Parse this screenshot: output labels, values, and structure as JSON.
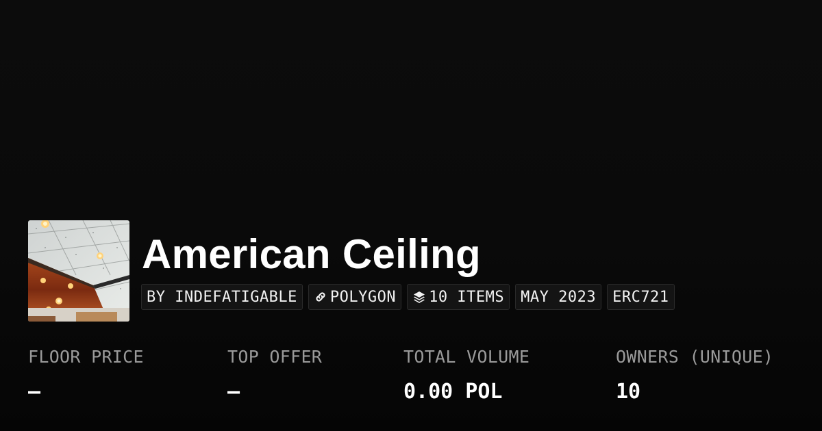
{
  "collection": {
    "title": "American Ceiling",
    "thumbnail_icon": "ceiling-artwork-image"
  },
  "pills": {
    "creator": "BY INDEFATIGABLE",
    "chain": "POLYGON",
    "chain_icon": "link-icon",
    "items": "10 ITEMS",
    "items_icon": "layers-icon",
    "date": "MAY 2023",
    "standard": "ERC721"
  },
  "stats": {
    "floor_price": {
      "label": "FLOOR PRICE",
      "value": "–"
    },
    "top_offer": {
      "label": "TOP OFFER",
      "value": "–"
    },
    "total_volume": {
      "label": "TOTAL VOLUME",
      "value": "0.00 POL"
    },
    "owners": {
      "label": "OWNERS (UNIQUE)",
      "value": "10"
    }
  },
  "colors": {
    "background": "#0a0a0a",
    "text": "#ffffff",
    "muted": "#9a9a9a",
    "pill_border": "#2a2a2a"
  }
}
